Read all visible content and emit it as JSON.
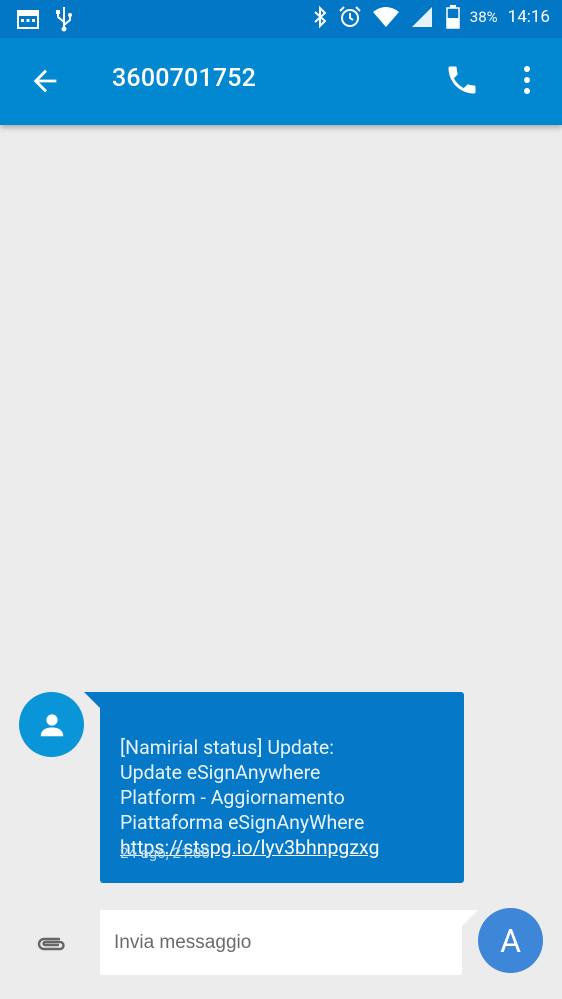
{
  "status_bar": {
    "battery_percent": "38%",
    "time": "14:16"
  },
  "app_bar": {
    "title": "3600701752"
  },
  "message": {
    "text": "[Namirial status] Update:\nUpdate eSignAnywhere\nPlatform - Aggiornamento\nPiattaforma eSignAnyWhere",
    "link": "https://stspg.io/lyv3bhnpgzxg",
    "timestamp": "24 ago, 21:00"
  },
  "composer": {
    "placeholder": "Invia messaggio",
    "send_label": "A"
  },
  "colors": {
    "status_bar": "#0277c5",
    "app_bar": "#0288d1",
    "bubble": "#0578c8",
    "background": "#ececec",
    "send_button": "#3d86d8"
  }
}
